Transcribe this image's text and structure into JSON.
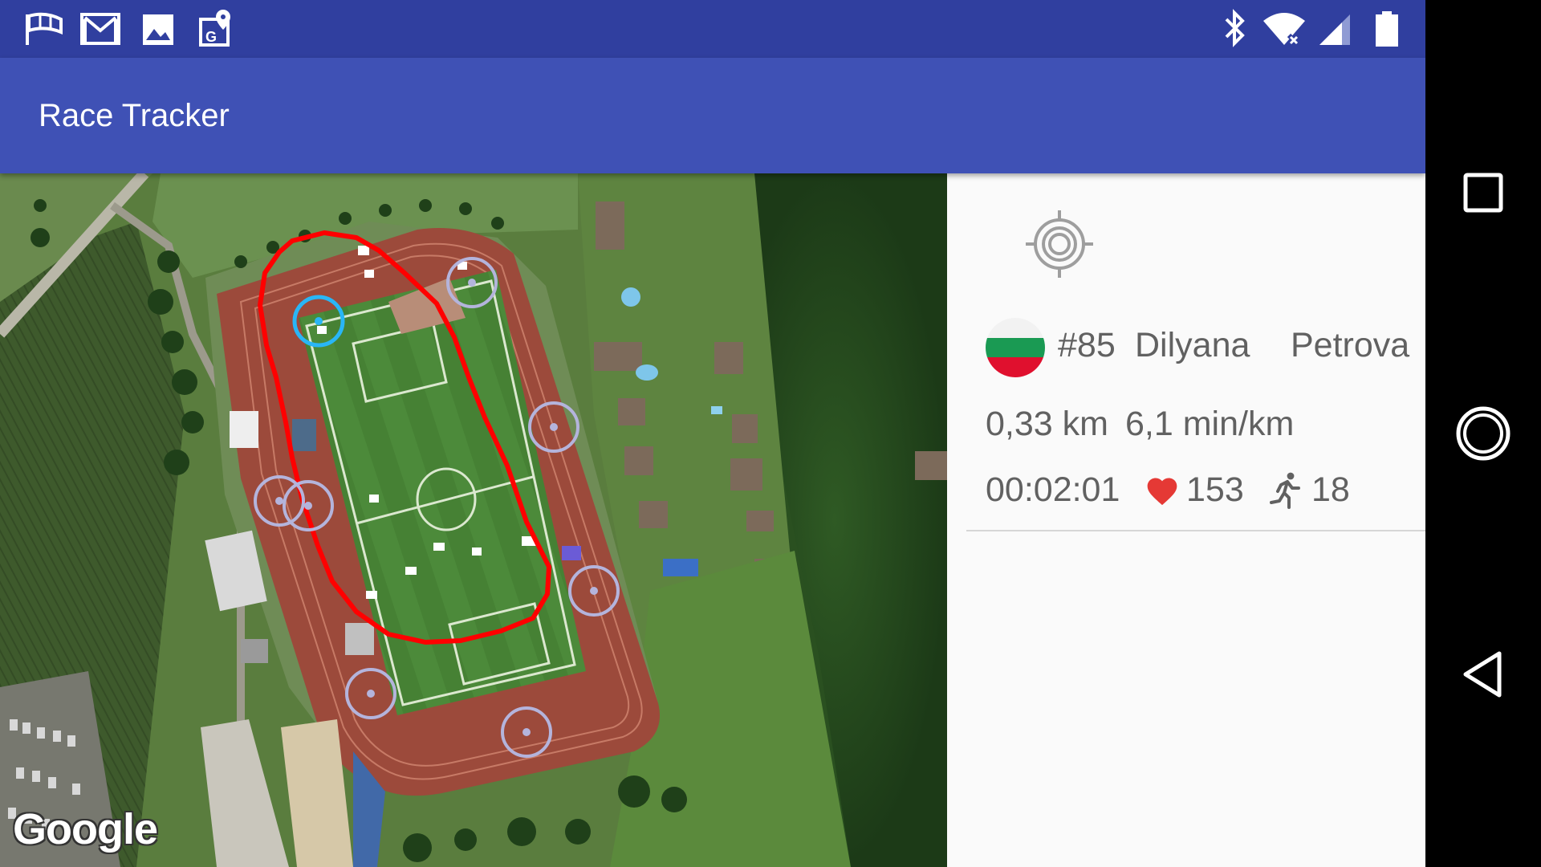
{
  "status_bar": {
    "notification_icons": [
      "windsock-icon",
      "gmail-icon",
      "gallery-icon",
      "maps-icon"
    ],
    "system_icons": [
      "bluetooth-icon",
      "wifi-x-icon",
      "cell-signal-icon",
      "battery-icon"
    ],
    "color": "#303f9f"
  },
  "app_bar": {
    "title": "Race Tracker",
    "color": "#3f51b5"
  },
  "map": {
    "attribution": "Google",
    "track_color": "#ff0000",
    "markers": [
      {
        "name": "checkpoint-marker",
        "active": true
      },
      {
        "name": "checkpoint-marker",
        "active": false
      },
      {
        "name": "checkpoint-marker",
        "active": false
      },
      {
        "name": "checkpoint-marker",
        "active": false
      },
      {
        "name": "checkpoint-marker",
        "active": false
      },
      {
        "name": "checkpoint-marker",
        "active": false
      },
      {
        "name": "checkpoint-marker",
        "active": false
      },
      {
        "name": "checkpoint-marker",
        "active": false
      }
    ]
  },
  "panel": {
    "locate_icon": "crosshair-target-icon",
    "athlete": {
      "flag": "bulgaria-flag",
      "number": "#85",
      "first_name": "Dilyana",
      "last_name": "Petrova"
    },
    "distance": "0,33 km",
    "pace": "6,1 min/km",
    "elapsed_time": "00:02:01",
    "heart_rate": "153",
    "heart_icon": "heart-icon",
    "heart_color": "#e53935",
    "cadence": "18",
    "runner_icon": "runner-icon"
  },
  "nav_bar": {
    "buttons": [
      "recents-button",
      "home-button",
      "back-button"
    ]
  }
}
